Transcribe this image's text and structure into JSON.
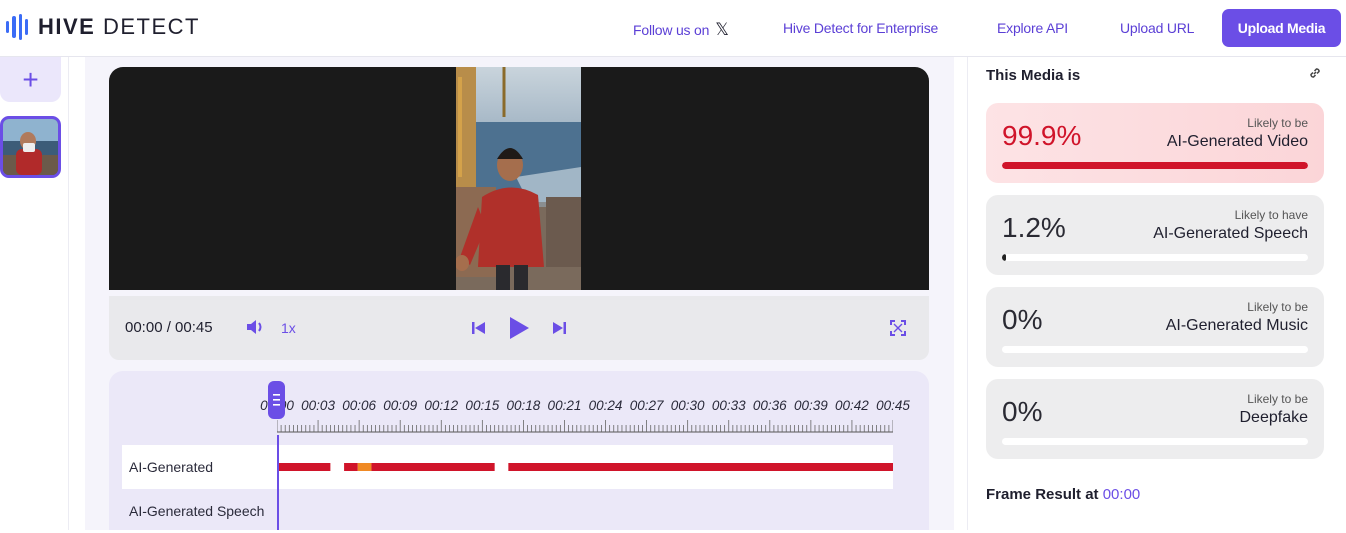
{
  "header": {
    "brand_bold": "HIVE",
    "brand_light": "DETECT",
    "follow_label": "Follow us on",
    "enterprise_label": "Hive Detect for Enterprise",
    "api_label": "Explore API",
    "upload_url_label": "Upload URL",
    "upload_media_label": "Upload Media"
  },
  "player": {
    "time_display": "00:00 / 00:45",
    "speed": "1x"
  },
  "timeline": {
    "tick_labels": [
      "00:00",
      "00:03",
      "00:06",
      "00:09",
      "00:12",
      "00:15",
      "00:18",
      "00:21",
      "00:24",
      "00:27",
      "00:30",
      "00:33",
      "00:36",
      "00:39",
      "00:42",
      "00:45"
    ],
    "rows": [
      {
        "label": "AI-Generated"
      },
      {
        "label": "AI-Generated Speech"
      }
    ],
    "playhead_seconds": 0,
    "duration_seconds": 45,
    "ai_generated_segments": [
      {
        "start": 0.0,
        "end": 3.9,
        "color": "#d0142a"
      },
      {
        "start": 4.9,
        "end": 5.9,
        "color": "#d0142a"
      },
      {
        "start": 5.9,
        "end": 6.9,
        "color": "#f08a24"
      },
      {
        "start": 6.9,
        "end": 15.9,
        "color": "#d0142a"
      },
      {
        "start": 16.9,
        "end": 45.0,
        "color": "#d0142a"
      }
    ]
  },
  "results": {
    "title": "This Media is",
    "cards": [
      {
        "pct": "99.9%",
        "sub": "Likely to be",
        "main": "AI-Generated Video",
        "fill": 0.999,
        "hot": true
      },
      {
        "pct": "1.2%",
        "sub": "Likely to have",
        "main": "AI-Generated Speech",
        "fill": 0.012,
        "hot": false
      },
      {
        "pct": "0%",
        "sub": "Likely to be",
        "main": "AI-Generated Music",
        "fill": 0,
        "hot": false
      },
      {
        "pct": "0%",
        "sub": "Likely to be",
        "main": "Deepfake",
        "fill": 0,
        "hot": false
      }
    ],
    "frame_result_label": "Frame Result at",
    "frame_result_time": "00:00"
  },
  "colors": {
    "accent": "#6b4ee6",
    "alert": "#d0142a",
    "brand_blue": "#3b6cf6"
  }
}
